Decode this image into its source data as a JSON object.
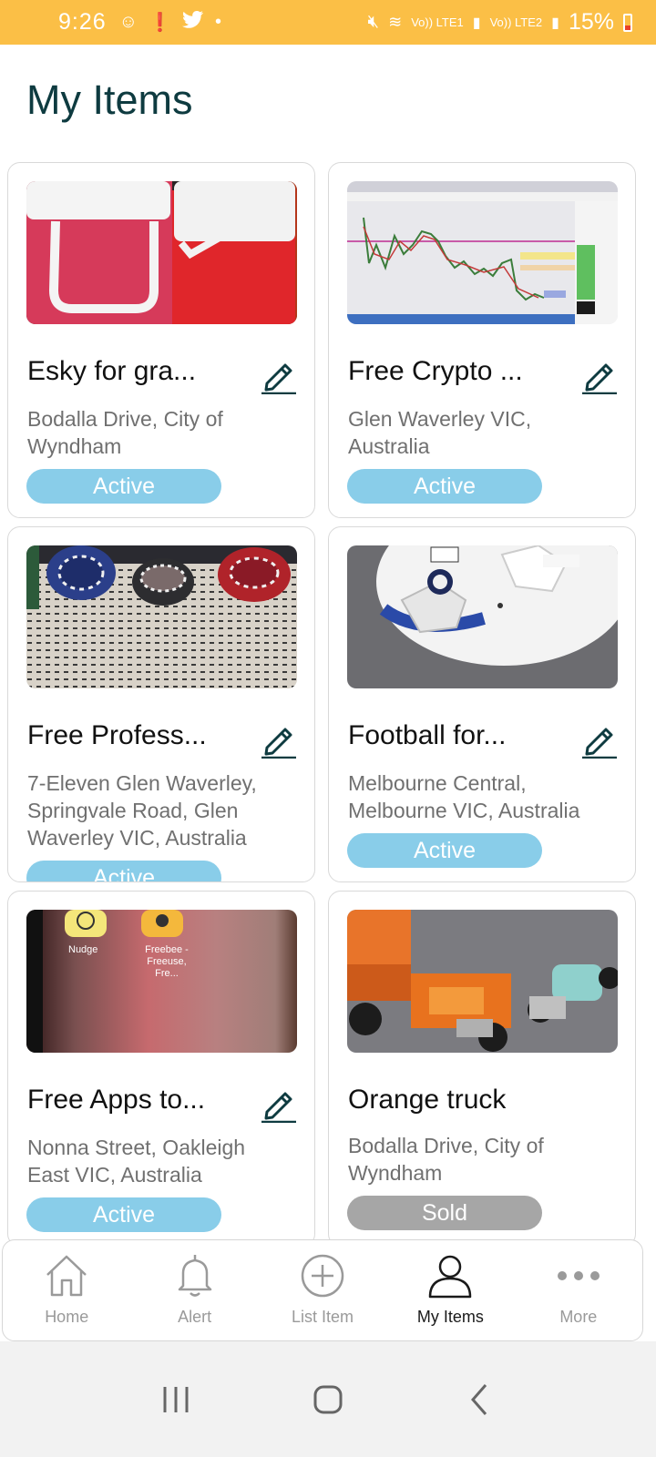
{
  "status_bar": {
    "time": "9:26",
    "battery": "15%",
    "network_1": "Vo)) LTE1",
    "network_2": "Vo)) LTE2"
  },
  "page": {
    "title": "My Items"
  },
  "items": [
    {
      "title": "Esky for gra...",
      "location": "Bodalla Drive, City of Wyndham",
      "status": "Active",
      "editable": true,
      "image": "red and white eskies"
    },
    {
      "title": "Free Crypto ...",
      "location": "Glen Waverley VIC, Australia",
      "status": "Active",
      "editable": true,
      "image": "trading chart screen"
    },
    {
      "title": "Free Profess...",
      "location": "7-Eleven Glen Waverley, Springvale Road, Glen Waverley VIC, Australia",
      "status": "Active",
      "editable": true,
      "image": "poker chips"
    },
    {
      "title": "Football for...",
      "location": "Melbourne Central, Melbourne VIC, Australia",
      "status": "Active",
      "editable": true,
      "image": "soccer ball"
    },
    {
      "title": "Free Apps to...",
      "location": "Nonna Street, Oakleigh East VIC, Australia",
      "status": "Active",
      "editable": true,
      "image": "phone app screen",
      "app_labels": [
        "Nudge",
        "Freebee - Freeuse, Fre..."
      ]
    },
    {
      "title": "Orange truck",
      "location": "Bodalla Drive, City of Wyndham",
      "status": "Sold",
      "editable": false,
      "image": "toy orange truck"
    }
  ],
  "nav": {
    "items": [
      {
        "label": "Home",
        "icon": "home-icon"
      },
      {
        "label": "Alert",
        "icon": "bell-icon"
      },
      {
        "label": "List Item",
        "icon": "plus-circle-icon"
      },
      {
        "label": "My Items",
        "icon": "person-icon",
        "active": true
      },
      {
        "label": "More",
        "icon": "more-dots-icon"
      }
    ]
  },
  "colors": {
    "status_bar": "#fbbf46",
    "title": "#0e3b40",
    "badge_active": "#89cde9",
    "badge_sold": "#a6a6a6",
    "edit_icon": "#0e3b40"
  }
}
